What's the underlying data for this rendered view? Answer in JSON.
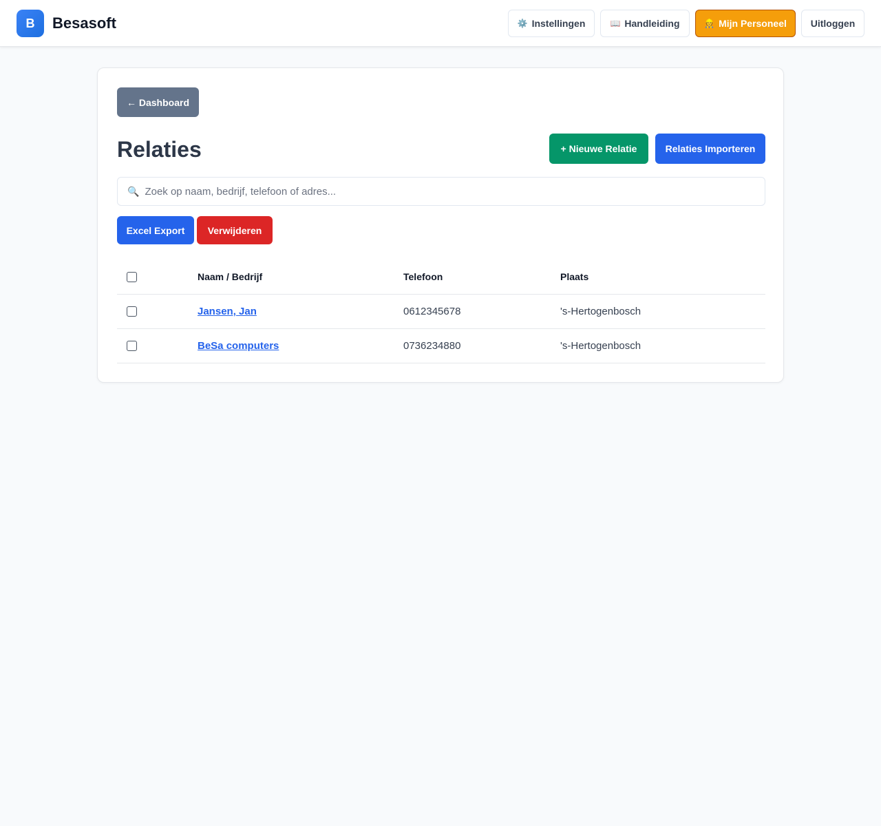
{
  "header": {
    "logo_letter": "B",
    "brand": "Besasoft",
    "nav": {
      "settings": {
        "icon": "⚙️",
        "label": "Instellingen"
      },
      "manual": {
        "icon": "📖",
        "label": "Handleiding"
      },
      "staff": {
        "icon": "👷",
        "label": "Mijn Personeel"
      },
      "logout": {
        "label": "Uitloggen"
      }
    }
  },
  "main": {
    "back_label": "← Dashboard",
    "title": "Relaties",
    "new_label": "+ Nieuwe Relatie",
    "import_label": "Relaties Importeren",
    "search": {
      "icon": "🔍",
      "placeholder": "Zoek op naam, bedrijf, telefoon of adres..."
    },
    "export_label": "Excel Export",
    "delete_label": "Verwijderen",
    "table": {
      "columns": [
        "Naam / Bedrijf",
        "Telefoon",
        "Plaats"
      ],
      "rows": [
        {
          "name": "Jansen, Jan",
          "phone": "0612345678",
          "city": "'s-Hertogenbosch"
        },
        {
          "name": "BeSa computers",
          "phone": "0736234880",
          "city": "'s-Hertogenbosch"
        }
      ]
    }
  },
  "colors": {
    "accent": "#2563eb",
    "success": "#059669",
    "danger": "#dc2626",
    "warning": "#f59e0b",
    "muted": "#64748b"
  }
}
